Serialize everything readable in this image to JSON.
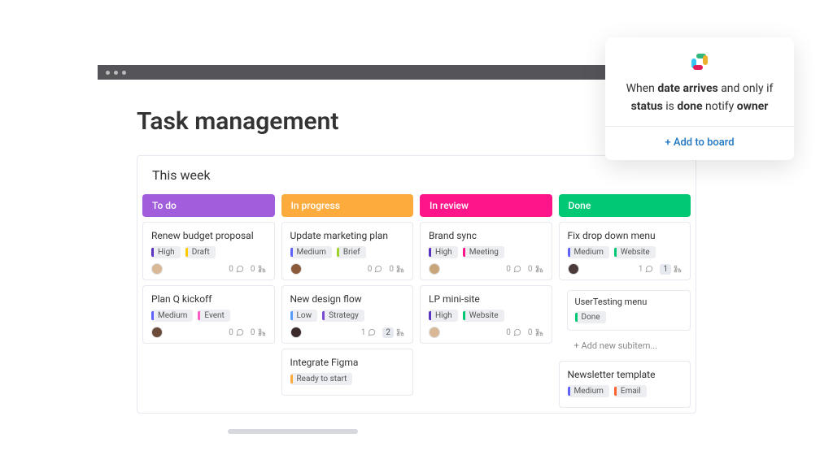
{
  "page_title": "Task management",
  "board_title": "This  week",
  "colors": {
    "todo": "#a25ddc",
    "in_progress": "#fdab3d",
    "in_review": "#ff158a",
    "done": "#00c875",
    "high": "#5a34c0",
    "medium": "#6161ff",
    "low": "#579bfc",
    "draft": "#ffcb00",
    "brief": "#9cd326",
    "event": "#ff5ac4",
    "strategy": "#784bd1",
    "meeting": "#ff158a",
    "website": "#00c875",
    "ready": "#fdab3d",
    "email": "#ff642e"
  },
  "columns": [
    {
      "title": "To do",
      "color": "#a25ddc",
      "cards": [
        {
          "title": "Renew budget proposal",
          "tags": [
            {
              "label": "High",
              "color": "#5a34c0"
            },
            {
              "label": "Draft",
              "color": "#ffcb00"
            }
          ],
          "avatar": "#d8b896",
          "comments": 0,
          "subitems": 0
        },
        {
          "title": "Plan Q kickoff",
          "tags": [
            {
              "label": "Medium",
              "color": "#6161ff"
            },
            {
              "label": "Event",
              "color": "#ff5ac4"
            }
          ],
          "avatar": "#6b4a3a",
          "comments": 0,
          "subitems": 0
        }
      ]
    },
    {
      "title": "In progress",
      "color": "#fdab3d",
      "cards": [
        {
          "title": "Update marketing plan",
          "tags": [
            {
              "label": "Medium",
              "color": "#6161ff"
            },
            {
              "label": "Brief",
              "color": "#9cd326"
            }
          ],
          "avatar": "#8a5a3a",
          "comments": 0,
          "subitems": 0
        },
        {
          "title": "New design flow",
          "tags": [
            {
              "label": "Low",
              "color": "#579bfc"
            },
            {
              "label": "Strategy",
              "color": "#784bd1"
            }
          ],
          "avatar": "#3a2a2a",
          "comments": 1,
          "subitems": 2,
          "subitems_hi": true
        },
        {
          "title": "Integrate Figma",
          "tags": [
            {
              "label": "Ready to start",
              "color": "#fdab3d"
            }
          ],
          "partial": true
        }
      ]
    },
    {
      "title": "In review",
      "color": "#ff158a",
      "cards": [
        {
          "title": "Brand sync",
          "tags": [
            {
              "label": "High",
              "color": "#5a34c0"
            },
            {
              "label": "Meeting",
              "color": "#ff158a"
            }
          ],
          "avatar": "#c9a67a",
          "comments": 0,
          "subitems": 0
        },
        {
          "title": "LP mini-site",
          "tags": [
            {
              "label": "High",
              "color": "#5a34c0"
            },
            {
              "label": "Website",
              "color": "#00c875"
            }
          ],
          "avatar": "#d8b896",
          "comments": 0,
          "subitems": 0
        }
      ]
    },
    {
      "title": "Done",
      "color": "#00c875",
      "cards": [
        {
          "title": "Fix drop down menu",
          "tags": [
            {
              "label": "Medium",
              "color": "#6161ff"
            },
            {
              "label": "Website",
              "color": "#00c875"
            }
          ],
          "avatar": "#4a3a3a",
          "comments": 1,
          "subitems": 1,
          "subitems_hi": true,
          "children": [
            {
              "title": "UserTesting menu",
              "tag": {
                "label": "Done",
                "color": "#00c875"
              }
            }
          ],
          "add_subitem": "+ Add new subitem..."
        },
        {
          "title": "Newsletter template",
          "tags": [
            {
              "label": "Medium",
              "color": "#6161ff"
            },
            {
              "label": "Email",
              "color": "#ff642e"
            }
          ],
          "partial": true
        }
      ]
    }
  ],
  "automation": {
    "parts": [
      "When ",
      "date arrives",
      " and only if ",
      "status",
      " is ",
      "done",
      " notify ",
      "owner"
    ],
    "add_to_board": "+ Add to board"
  }
}
